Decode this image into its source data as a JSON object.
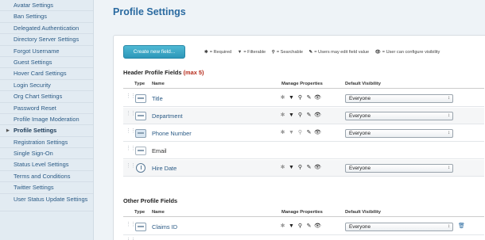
{
  "sidebar": {
    "items": [
      {
        "label": "Avatar Settings"
      },
      {
        "label": "Ban Settings"
      },
      {
        "label": "Delegated Authentication"
      },
      {
        "label": "Directory Server Settings"
      },
      {
        "label": "Forgot Username"
      },
      {
        "label": "Guest Settings"
      },
      {
        "label": "Hover Card Settings"
      },
      {
        "label": "Login Security"
      },
      {
        "label": "Org Chart Settings"
      },
      {
        "label": "Password Reset"
      },
      {
        "label": "Profile Image Moderation"
      },
      {
        "label": "Profile Settings"
      },
      {
        "label": "Registration Settings"
      },
      {
        "label": "Single Sign-On"
      },
      {
        "label": "Status Level Settings"
      },
      {
        "label": "Terms and Conditions"
      },
      {
        "label": "Twitter Settings"
      },
      {
        "label": "User Status Update Settings"
      }
    ],
    "active_index": 11
  },
  "page": {
    "title": "Profile Settings"
  },
  "toolbar": {
    "create_label": "Create new field..."
  },
  "legend": {
    "required": "= Required",
    "filterable": "= Filterable",
    "searchable": "= Searchable",
    "editable": "= Users may edit field value",
    "visibility": "= User can configure visibility"
  },
  "header_section": {
    "title": "Header Profile Fields",
    "max": "(max 5)",
    "columns": {
      "type": "Type",
      "name": "Name",
      "manage": "Manage Properties",
      "visibility": "Default Visibility"
    },
    "rows": [
      {
        "name": "Title",
        "visibility": "Everyone",
        "icon": "text-field-icon"
      },
      {
        "name": "Department",
        "visibility": "Everyone",
        "icon": "text-field-icon"
      },
      {
        "name": "Phone Number",
        "visibility": "Everyone",
        "icon": "phone-field-icon"
      },
      {
        "name": "Email",
        "visibility": "",
        "icon": "email-field-icon"
      },
      {
        "name": "Hire Date",
        "visibility": "Everyone",
        "icon": "date-field-icon"
      }
    ]
  },
  "other_section": {
    "title": "Other Profile Fields",
    "columns": {
      "type": "Type",
      "name": "Name",
      "manage": "Manage Properties",
      "visibility": "Default Visibility"
    },
    "rows": [
      {
        "name": "Claims ID",
        "visibility": "Everyone",
        "icon": "text-field-icon"
      }
    ]
  },
  "colors": {
    "accent": "#2a6aa0",
    "button": "#3aa7c6",
    "max_warning": "#b52a1a",
    "sidebar_bg": "#e2ebf2"
  }
}
